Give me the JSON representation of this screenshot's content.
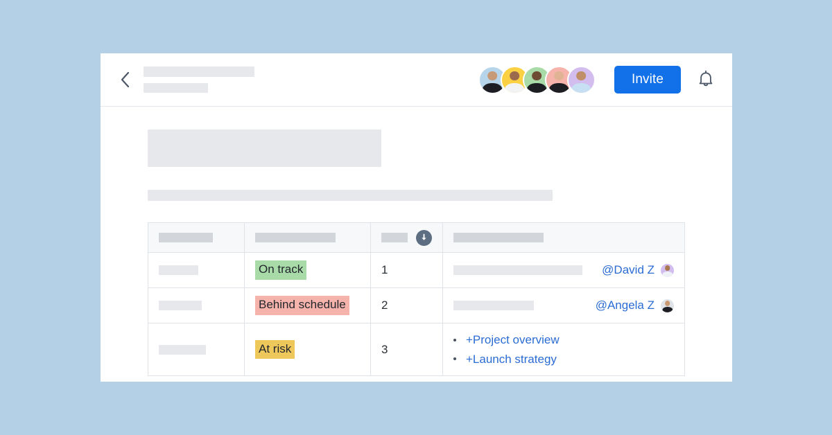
{
  "window": {
    "background_color": "#b4d0e7",
    "card_background": "#ffffff"
  },
  "topbar": {
    "back_icon": "chevron-left-icon",
    "title_placeholder": "",
    "subtitle_placeholder": "",
    "invite_label": "Invite",
    "invite_color": "#1271e8",
    "bell_icon": "bell-icon",
    "avatars": [
      {
        "name": "member-1",
        "bg": "#b7d5ea",
        "shirt": "#1c1e24",
        "skin": "#c79a77"
      },
      {
        "name": "member-2",
        "bg": "#fbd042",
        "shirt": "#f2f3f5",
        "skin": "#9b6a4d"
      },
      {
        "name": "member-3",
        "bg": "#a9dba9",
        "shirt": "#1c1e24",
        "skin": "#6e4c33"
      },
      {
        "name": "member-4",
        "bg": "#f6b3ab",
        "shirt": "#1c1e24",
        "skin": "#e0b394"
      },
      {
        "name": "member-5",
        "bg": "#d3bdef",
        "shirt": "#c6dff2",
        "skin": "#c08f68"
      }
    ]
  },
  "content": {
    "heading_placeholder": "",
    "paragraph_placeholder": ""
  },
  "table": {
    "headers": [
      {
        "placeholder": "",
        "sort_icon": null
      },
      {
        "placeholder": "",
        "sort_icon": null
      },
      {
        "placeholder": "",
        "sort_icon": "sort-descending-icon"
      },
      {
        "placeholder": "",
        "sort_icon": null
      }
    ],
    "rows": [
      {
        "name_placeholder": "",
        "status": {
          "label": "On track",
          "color": "#a9dba9"
        },
        "number": "1",
        "note": {
          "type": "mention",
          "text_placeholder": "",
          "mention": "@David Z",
          "avatar": {
            "name": "david-z-avatar",
            "bg": "#d3bdef",
            "shirt": "#eef2f6",
            "skin": "#a9784f"
          }
        }
      },
      {
        "name_placeholder": "",
        "status": {
          "label": "Behind schedule",
          "color": "#f6b3ab"
        },
        "number": "2",
        "note": {
          "type": "mention",
          "text_placeholder": "",
          "mention": "@Angela Z",
          "avatar": {
            "name": "angela-z-avatar",
            "bg": "#dfe3e8",
            "shirt": "#1c1e24",
            "skin": "#c89871"
          }
        }
      },
      {
        "name_placeholder": "",
        "status": {
          "label": "At risk",
          "color": "#efc85c"
        },
        "number": "3",
        "note": {
          "type": "links",
          "links": [
            "+Project overview",
            "+Launch strategy"
          ],
          "link_color": "#2b6cd4"
        }
      }
    ]
  }
}
